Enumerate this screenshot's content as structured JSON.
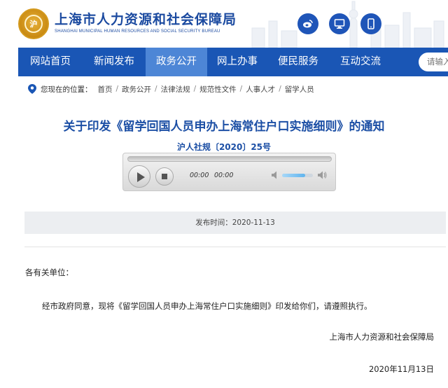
{
  "header": {
    "title": "上海市人力资源和社会保障局",
    "subtitle": "SHANGHAI MUNICIPAL HUMAN RESOURCES AND SOCIAL SECURITY BUREAU",
    "icons": [
      "weibo-icon",
      "desktop-icon",
      "mobile-icon"
    ]
  },
  "nav": {
    "items": [
      {
        "label": "网站首页",
        "active": false
      },
      {
        "label": "新闻发布",
        "active": false
      },
      {
        "label": "政务公开",
        "active": true
      },
      {
        "label": "网上办事",
        "active": false
      },
      {
        "label": "便民服务",
        "active": false
      },
      {
        "label": "互动交流",
        "active": false
      }
    ],
    "search_placeholder": "请输入"
  },
  "breadcrumb": {
    "lead": "您现在的位置：",
    "items": [
      "首页",
      "政务公开",
      "法律法规",
      "规范性文件",
      "人事人才",
      "留学人员"
    ]
  },
  "article": {
    "title": "关于印发《留学回国人员申办上海常住户口实施细则》的通知",
    "doc_number": "沪人社规〔2020〕25号",
    "publish_label": "发布时间：2020-11-13",
    "salutation": "各有关单位：",
    "paragraph": "经市政府同意，现将《留学回国人员申办上海常住户口实施细则》印发给你们，请遵照执行。",
    "signature": "上海市人力资源和社会保障局",
    "date": "2020年11月13日"
  },
  "player": {
    "current_time": "00:00",
    "duration": "00:00",
    "volume": 0.75,
    "progress": 0
  },
  "colors": {
    "brand_blue": "#1a56b5",
    "nav_active": "#4d86d6",
    "title_blue": "#1c4fa5"
  }
}
